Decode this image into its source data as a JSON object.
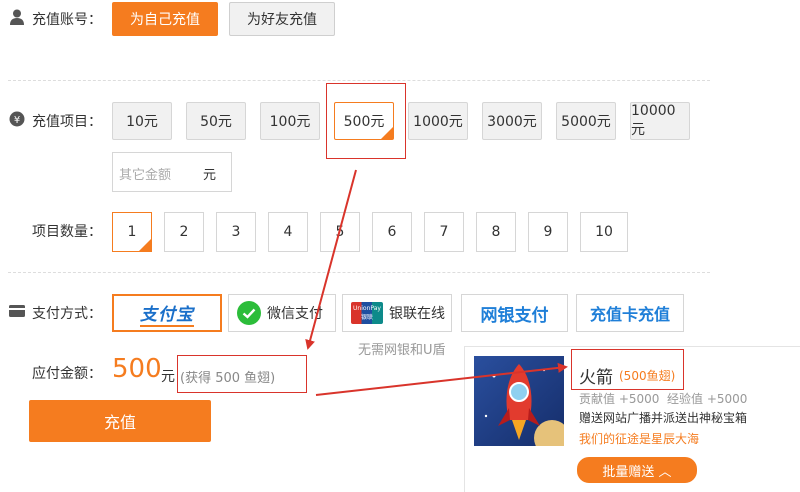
{
  "account": {
    "label": "充值账号：",
    "self_btn": "为自己充值",
    "friend_btn": "为好友充值"
  },
  "items": {
    "label": "充值项目：",
    "options": [
      "10元",
      "50元",
      "100元",
      "500元",
      "1000元",
      "3000元",
      "5000元",
      "10000元"
    ],
    "selected_index": 3,
    "other_placeholder": "其它金额",
    "other_unit": "元"
  },
  "quantity": {
    "label": "项目数量：",
    "options": [
      "1",
      "2",
      "3",
      "4",
      "5",
      "6",
      "7",
      "8",
      "9",
      "10"
    ],
    "selected_index": 0
  },
  "payment": {
    "label": "支付方式：",
    "alipay": "支付宝",
    "wechat": "微信支付",
    "unionpay": "银联在线",
    "unionpay_logo": "UnionPay",
    "unionpay_logo_cn": "银联",
    "netbank": "网银支付",
    "card": "充值卡充值",
    "note": "无需网银和U盾"
  },
  "amount": {
    "label": "应付金额：",
    "value": "500",
    "unit": "元",
    "bonus": "(获得 500 鱼翅)",
    "submit": "充值"
  },
  "gift": {
    "title": "火箭",
    "subtitle": "(500鱼翅)",
    "stat1": "贡献值 +5000",
    "stat2": "经验值 +5000",
    "desc": "赠送网站广播并派送出神秘宝箱",
    "slogan": "我们的征途是星辰大海",
    "batch_btn": "批量赠送 ︿"
  },
  "colors": {
    "accent": "#f57c1f",
    "annotation": "#d9342b",
    "blue": "#1f7fd8"
  }
}
